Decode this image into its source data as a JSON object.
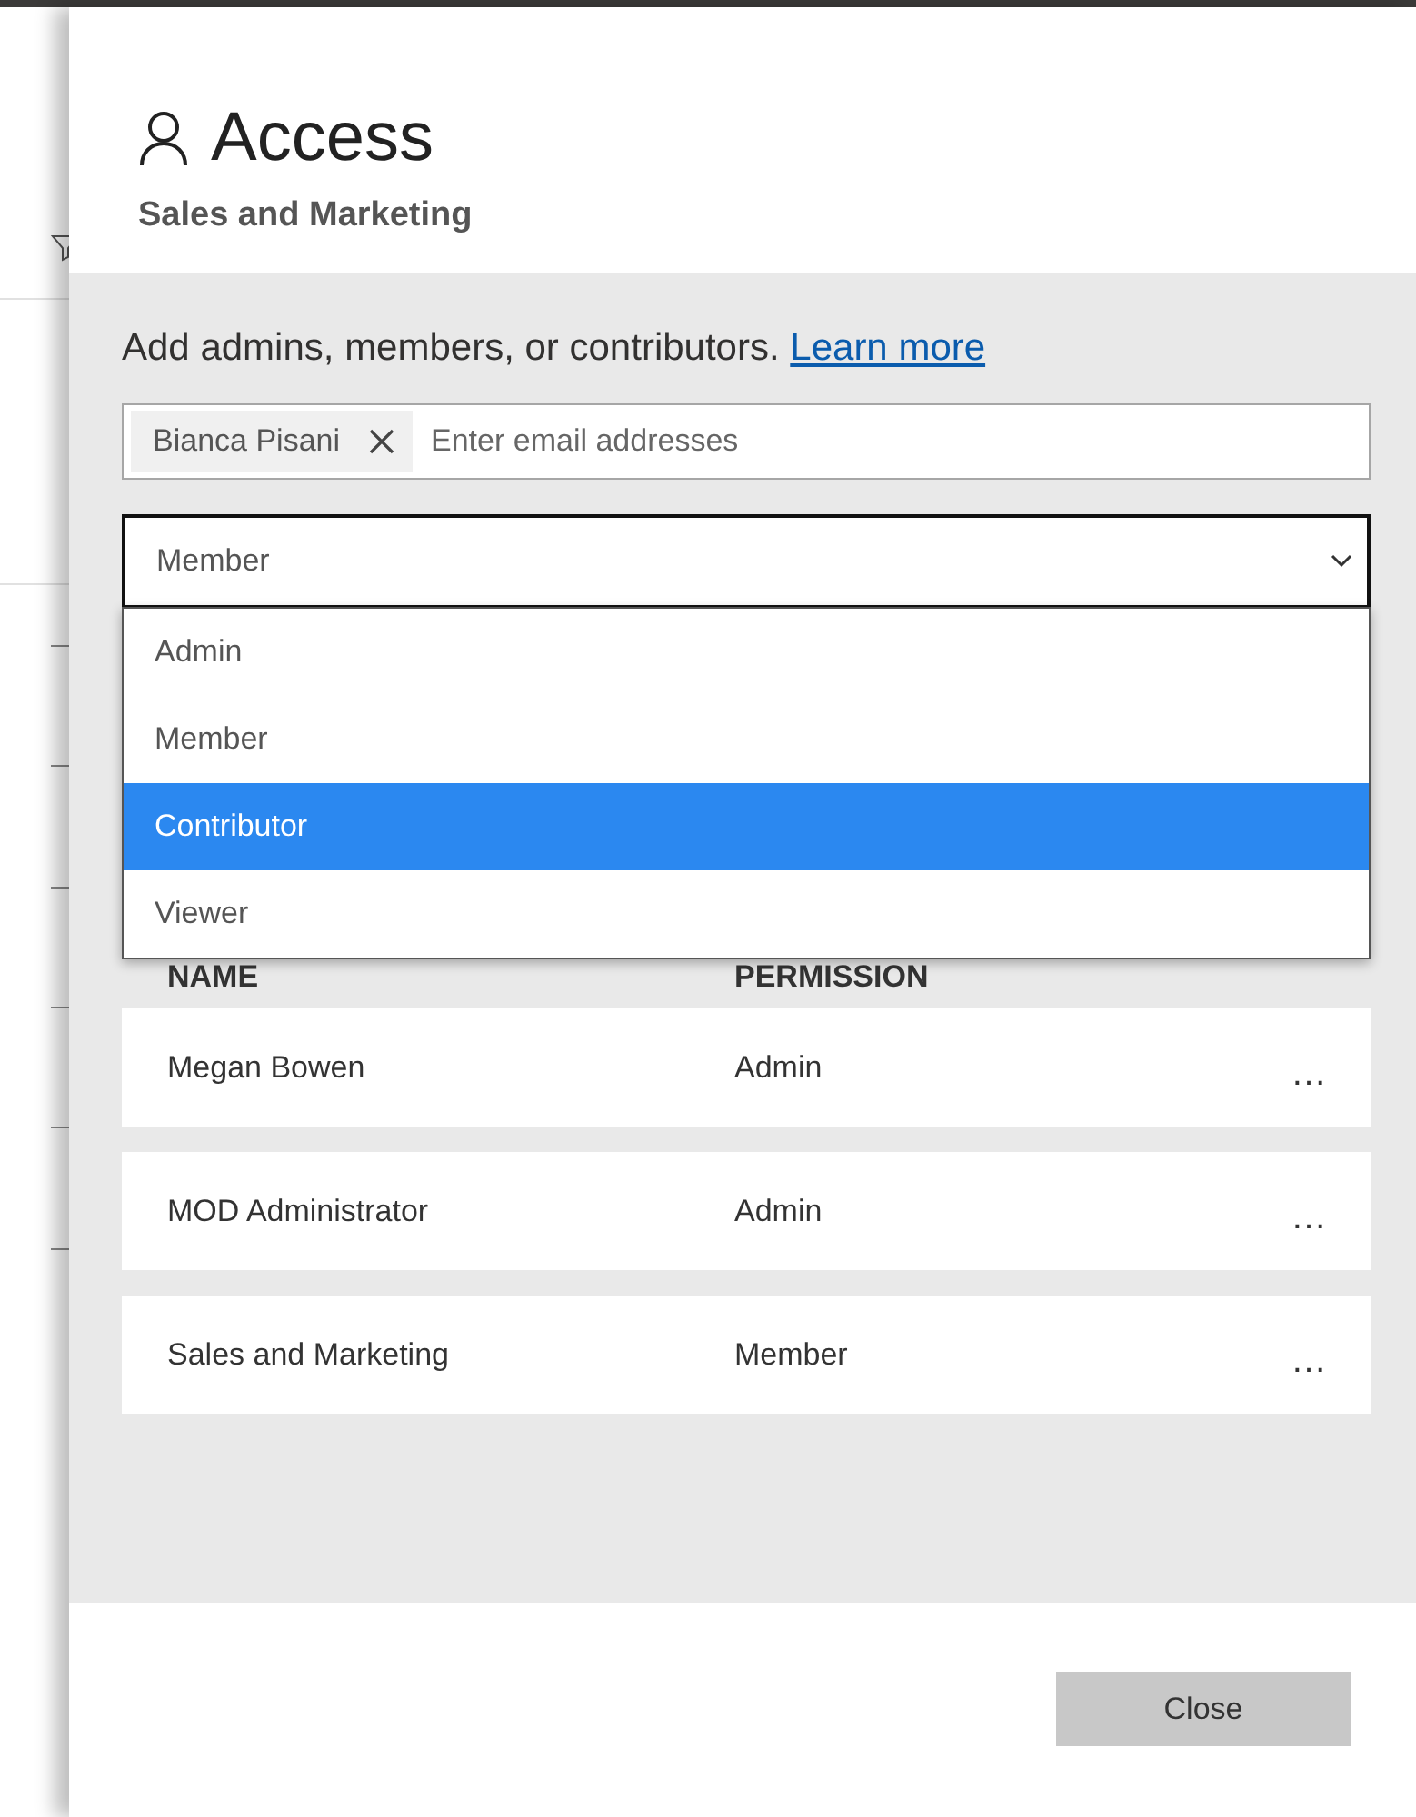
{
  "panel": {
    "title": "Access",
    "subtitle": "Sales and Marketing"
  },
  "invite": {
    "prompt": "Add admins, members, or contributors.",
    "link": "Learn more",
    "chips": [
      {
        "label": "Bianca Pisani"
      }
    ],
    "placeholder": "Enter email addresses"
  },
  "role_select": {
    "value": "Member",
    "expanded": true,
    "options": [
      {
        "label": "Admin",
        "highlighted": false
      },
      {
        "label": "Member",
        "highlighted": false
      },
      {
        "label": "Contributor",
        "highlighted": true
      },
      {
        "label": "Viewer",
        "highlighted": false
      }
    ]
  },
  "table": {
    "columns": [
      "NAME",
      "PERMISSION"
    ],
    "rows": [
      {
        "name": "Megan Bowen",
        "permission": "Admin",
        "menu": "…"
      },
      {
        "name": "MOD Administrator",
        "permission": "Admin",
        "menu": "…"
      },
      {
        "name": "Sales and Marketing",
        "permission": "Member",
        "menu": "…"
      }
    ]
  },
  "footer": {
    "button": "Close"
  }
}
